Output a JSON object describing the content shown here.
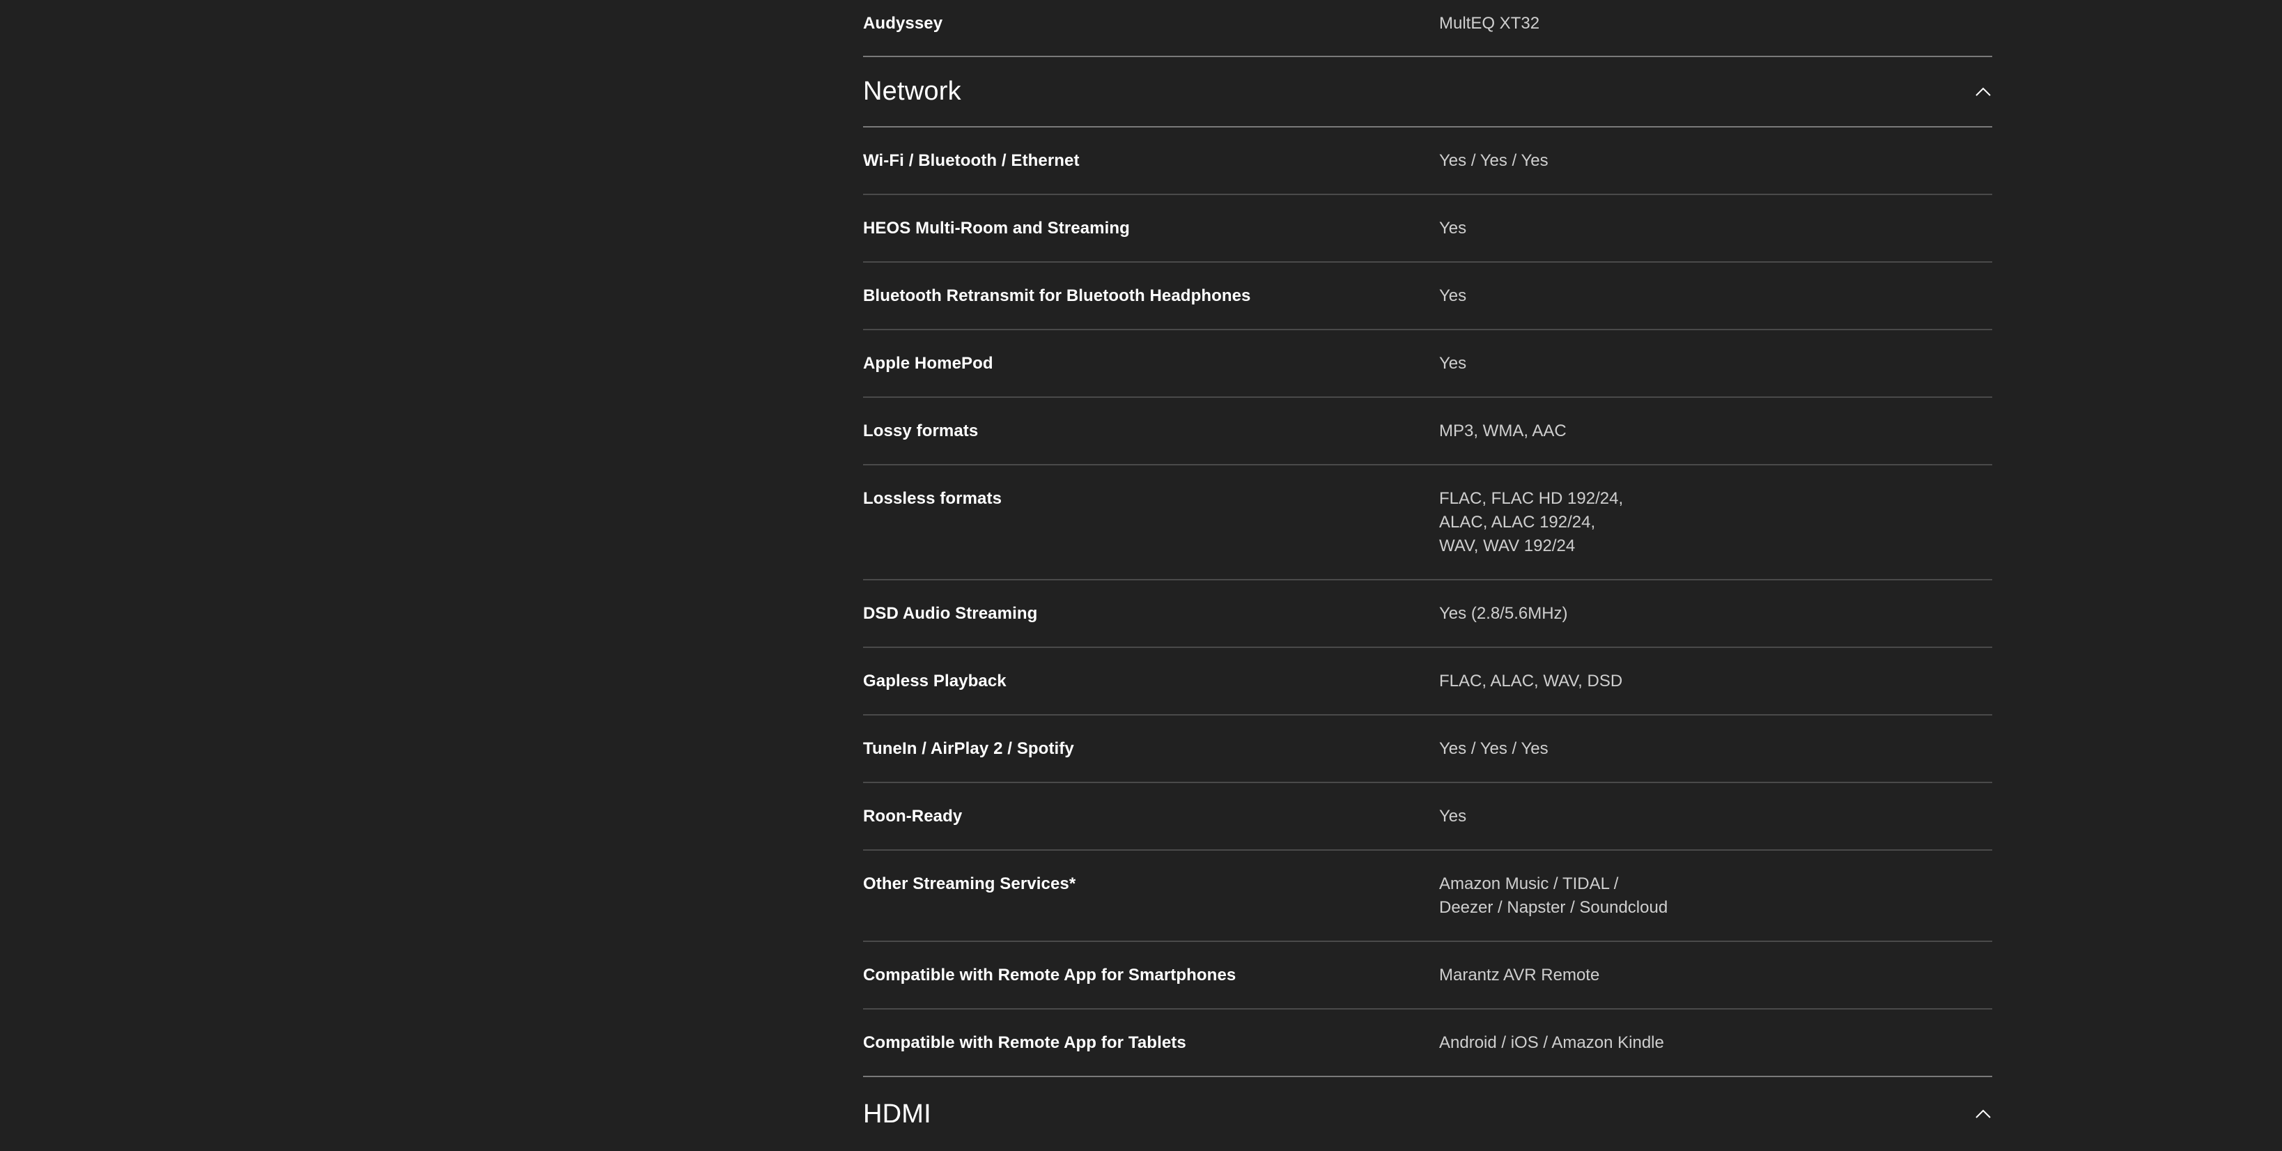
{
  "top_row": {
    "label": "Audyssey",
    "value": "MultEQ XT32"
  },
  "network": {
    "title": "Network",
    "toggle_icon": "chevron-up-icon",
    "rows": [
      {
        "label": "Wi-Fi / Bluetooth / Ethernet",
        "value": "Yes / Yes / Yes"
      },
      {
        "label": "HEOS Multi-Room and Streaming",
        "value": "Yes"
      },
      {
        "label": "Bluetooth Retransmit for Bluetooth Headphones",
        "value": "Yes"
      },
      {
        "label": "Apple HomePod",
        "value": "Yes"
      },
      {
        "label": "Lossy formats",
        "value": "MP3, WMA, AAC"
      },
      {
        "label": "Lossless formats",
        "value": "FLAC, FLAC HD 192/24,\nALAC, ALAC 192/24,\nWAV, WAV 192/24"
      },
      {
        "label": "DSD Audio Streaming",
        "value": "Yes (2.8/5.6MHz)"
      },
      {
        "label": "Gapless Playback",
        "value": "FLAC, ALAC, WAV, DSD"
      },
      {
        "label": "TuneIn / AirPlay 2 / Spotify",
        "value": "Yes / Yes / Yes"
      },
      {
        "label": "Roon-Ready",
        "value": "Yes"
      },
      {
        "label": "Other Streaming Services*",
        "value": "Amazon Music / TIDAL /\nDeezer / Napster / Soundcloud"
      },
      {
        "label": "Compatible with Remote App for Smartphones",
        "value": "Marantz AVR Remote"
      },
      {
        "label": "Compatible with Remote App for Tablets",
        "value": "Android / iOS / Amazon Kindle"
      }
    ]
  },
  "hdmi": {
    "title": "HDMI",
    "toggle_icon": "chevron-up-icon"
  },
  "colors": {
    "background": "#212121",
    "label": "#ffffff",
    "value": "#cfcfcf",
    "divider": "#4a4a4a",
    "section_divider": "#7a7a7a"
  }
}
